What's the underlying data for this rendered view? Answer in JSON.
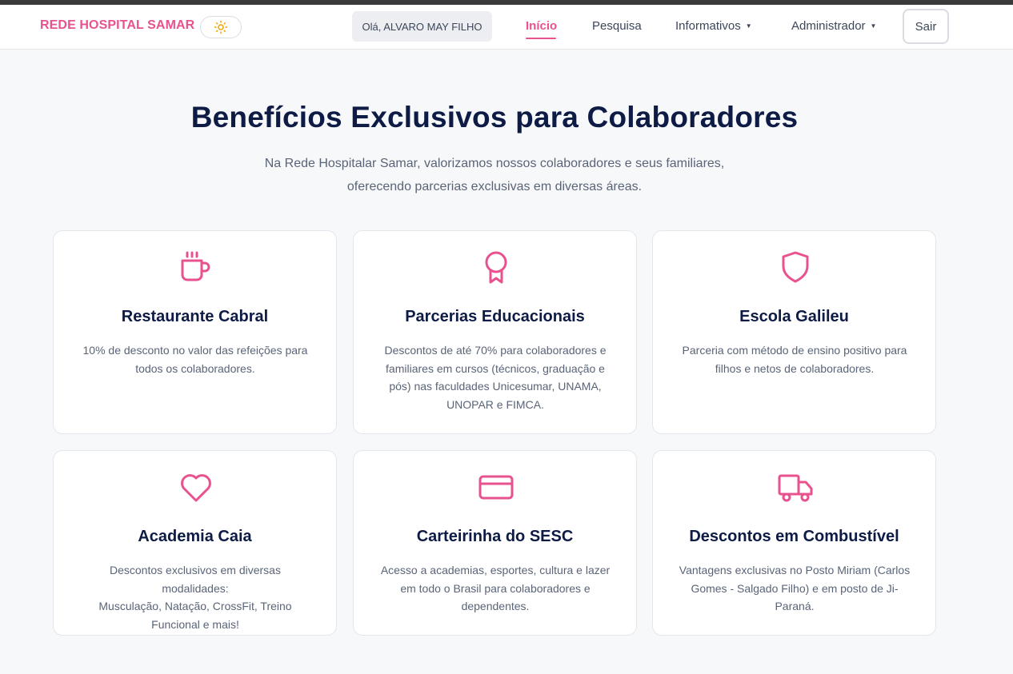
{
  "colors": {
    "accent": "#e8528f",
    "title": "#0d1b45",
    "muted": "#5a6477",
    "background": "#f7f8fa"
  },
  "nav": {
    "brand": "REDE HOSPITAL SAMAR",
    "theme_icon": "sun-icon",
    "greeting": "Olá, ALVARO MAY FILHO",
    "links": [
      {
        "label": "Início",
        "active": true
      },
      {
        "label": "Pesquisa"
      },
      {
        "label": "Informativos",
        "dropdown": true
      },
      {
        "label": "Administrador",
        "dropdown": true
      }
    ],
    "logout": "Sair"
  },
  "hero": {
    "title": "Benefícios Exclusivos para Colaboradores",
    "subtitle_line1": "Na Rede Hospitalar Samar, valorizamos nossos colaboradores e seus familiares,",
    "subtitle_line2": "oferecendo parcerias exclusivas em diversas áreas."
  },
  "cards": [
    {
      "icon": "coffee-cup-icon",
      "title": "Restaurante Cabral",
      "desc": [
        "10% de desconto no valor das refeições para",
        "todos os colaboradores."
      ]
    },
    {
      "icon": "award-ribbon-icon",
      "title": "Parcerias Educacionais",
      "desc": [
        "Descontos de até 70% para colaboradores e",
        "familiares em cursos (técnicos, graduação e",
        "pós) nas faculdades Unicesumar, UNAMA,",
        "UNOPAR e FIMCA."
      ]
    },
    {
      "icon": "shield-icon",
      "title": "Escola Galileu",
      "desc": [
        "Parceria com método de ensino positivo para",
        "filhos e netos de colaboradores."
      ]
    },
    {
      "icon": "heart-icon",
      "title": "Academia Caia",
      "desc": [
        "Descontos exclusivos em diversas modalidades:",
        "Musculação, Natação, CrossFit, Treino",
        "Funcional e mais!"
      ]
    },
    {
      "icon": "credit-card-icon",
      "title": "Carteirinha do SESC",
      "desc": [
        "Acesso a academias, esportes, cultura e lazer",
        "em todo o Brasil para colaboradores e",
        "dependentes."
      ]
    },
    {
      "icon": "truck-icon",
      "title": "Descontos em Combustível",
      "desc": [
        "Vantagens exclusivas no Posto Miriam (Carlos",
        "Gomes - Salgado Filho) e em posto de Ji-Paraná."
      ]
    }
  ]
}
